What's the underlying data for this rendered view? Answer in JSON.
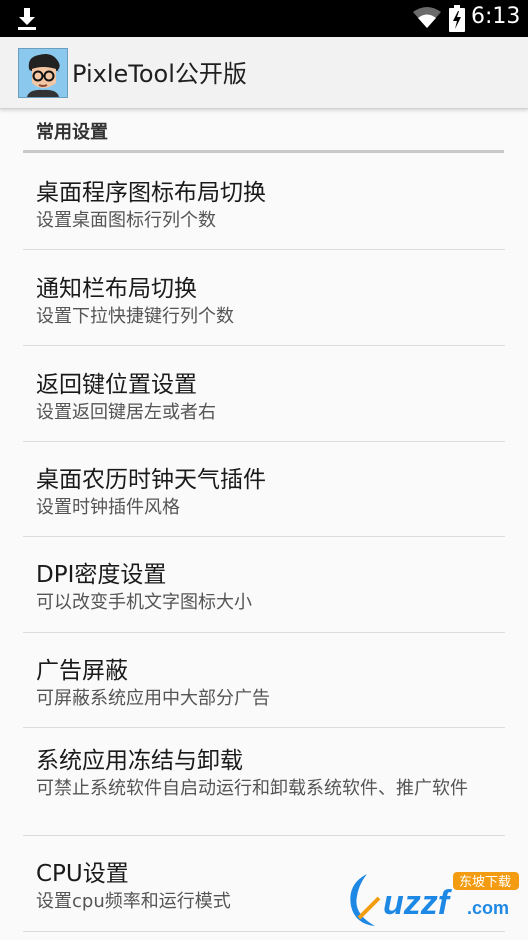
{
  "status_bar": {
    "time": "6:13",
    "icons": [
      "download-icon",
      "wifi-icon",
      "battery-charging-icon"
    ]
  },
  "app_bar": {
    "title": "PixleTool公开版",
    "avatar_icon": "cartoon-avatar-icon"
  },
  "section": {
    "title": "常用设置"
  },
  "items": [
    {
      "title": "桌面程序图标布局切换",
      "subtitle": "设置桌面图标行列个数"
    },
    {
      "title": "通知栏布局切换",
      "subtitle": "设置下拉快捷键行列个数"
    },
    {
      "title": "返回键位置设置",
      "subtitle": "设置返回键居左或者右"
    },
    {
      "title": "桌面农历时钟天气插件",
      "subtitle": "设置时钟插件风格"
    },
    {
      "title": "DPI密度设置",
      "subtitle": "可以改变手机文字图标大小"
    },
    {
      "title": "广告屏蔽",
      "subtitle": "可屏蔽系统应用中大部分广告"
    },
    {
      "title": "系统应用冻结与卸载",
      "subtitle": "可禁止系统软件自启动运行和卸载系统软件、推广软件"
    },
    {
      "title": "CPU设置",
      "subtitle": "设置cpu频率和运行模式"
    }
  ],
  "watermark": {
    "text": "uzzf",
    "suffix": ".com",
    "badge": "东坡下载"
  },
  "colors": {
    "status_bar": "#000000",
    "app_bar": "#f2f2f2",
    "background": "#fafafa",
    "divider": "#dcdcdc",
    "watermark_blue": "#1e88e5",
    "watermark_orange": "#f39c12"
  }
}
